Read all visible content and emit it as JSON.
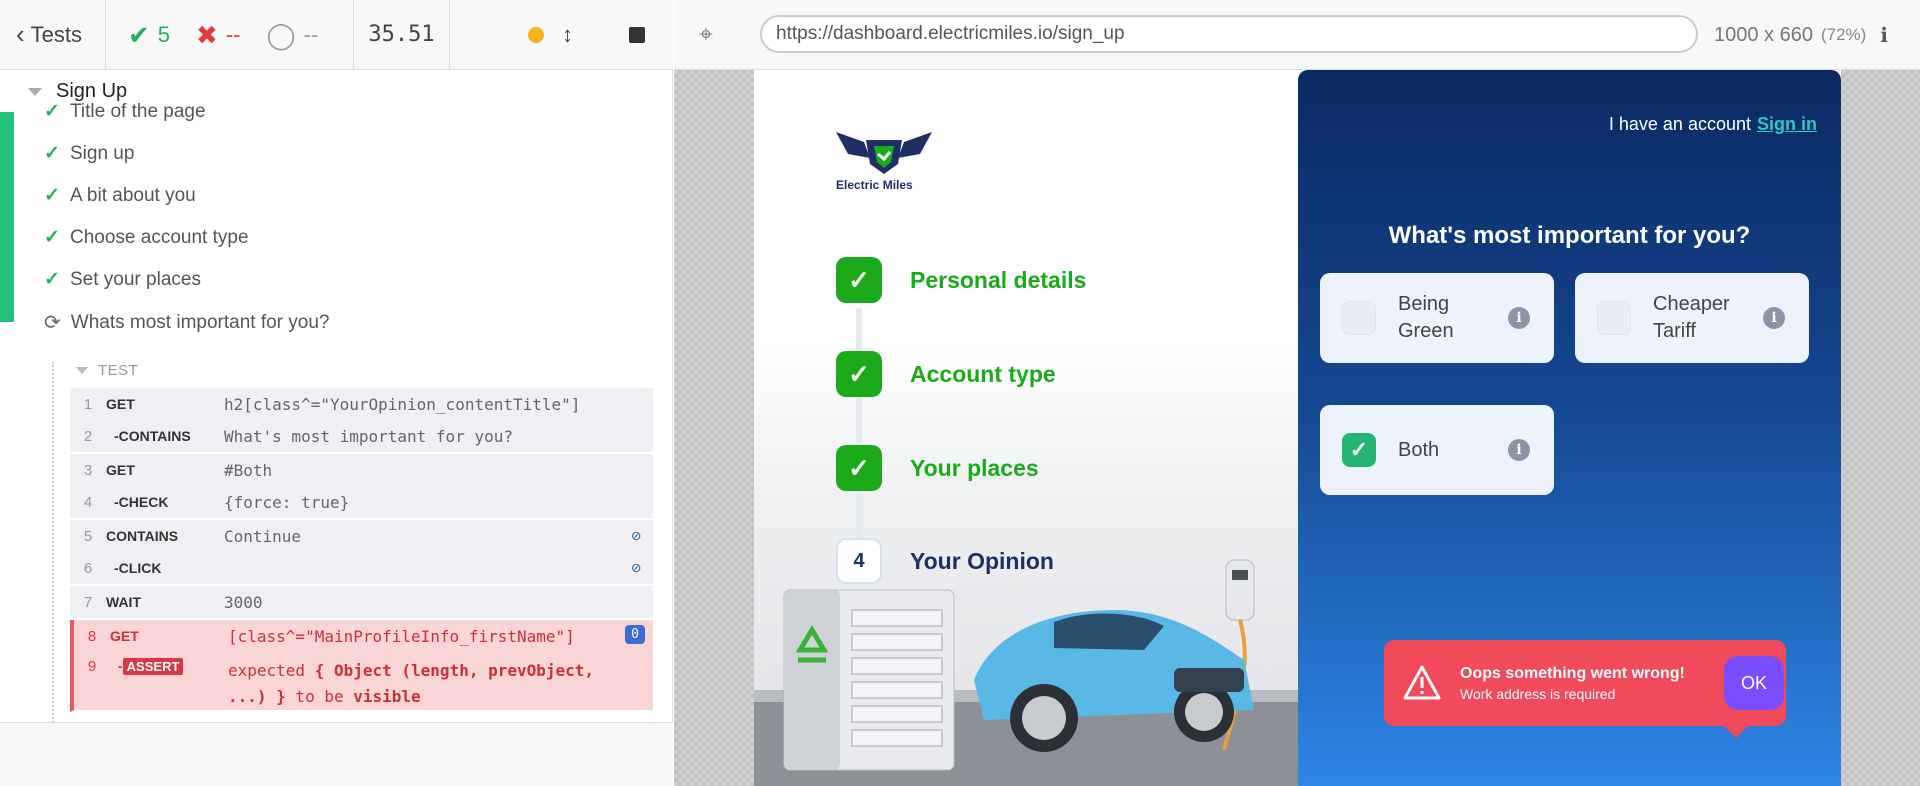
{
  "reporter": {
    "tests_label": "Tests",
    "passed": "5",
    "failed": "--",
    "pending": "--",
    "duration": "35.51",
    "suite_title": "Sign Up",
    "tests": [
      {
        "title": "Title of the page",
        "state": "passed"
      },
      {
        "title": "Sign up",
        "state": "passed"
      },
      {
        "title": "A bit about you",
        "state": "passed"
      },
      {
        "title": "Choose account type",
        "state": "passed"
      },
      {
        "title": "Set your places",
        "state": "passed"
      },
      {
        "title": "Whats most important for you?",
        "state": "running"
      }
    ],
    "test_label": "TEST",
    "commands": [
      {
        "n": "1",
        "name": "GET",
        "msg": "h2[class^=\"YourOpinion_contentTitle\"]"
      },
      {
        "n": "2",
        "name": "-CONTAINS",
        "msg": "What's most important for you?"
      },
      {
        "n": "3",
        "name": "GET",
        "msg": "#Both"
      },
      {
        "n": "4",
        "name": "-CHECK",
        "msg": "{force: true}"
      },
      {
        "n": "5",
        "name": "CONTAINS",
        "msg": "Continue"
      },
      {
        "n": "6",
        "name": "-CLICK",
        "msg": ""
      },
      {
        "n": "7",
        "name": "WAIT",
        "msg": "3000"
      },
      {
        "n": "8",
        "name": "GET",
        "msg": "[class^=\"MainProfileInfo_firstName\"]",
        "badge": "0"
      },
      {
        "n": "9",
        "name_prefix": "-",
        "name": "ASSERT",
        "msg_parts": [
          "expected ",
          "{ Object (length, prevObject, ...) }",
          " to be ",
          "visible"
        ]
      }
    ]
  },
  "aut": {
    "url": "https://dashboard.electricmiles.io/sign_up",
    "viewport": "1000 x 660",
    "scale": "(72%)"
  },
  "app": {
    "logo_text": "Electric Miles",
    "steps": [
      {
        "label": "Personal details",
        "state": "done"
      },
      {
        "label": "Account type",
        "state": "done"
      },
      {
        "label": "Your places",
        "state": "done"
      },
      {
        "label": "Your Opinion",
        "state": "current",
        "number": "4"
      }
    ],
    "have_account": "I have an account",
    "sign_in": "Sign in",
    "question": "What's most important for you?",
    "options": [
      {
        "label": "Being Green",
        "checked": false
      },
      {
        "label": "Cheaper Tariff",
        "checked": false
      },
      {
        "label": "Both",
        "checked": true
      }
    ],
    "toast": {
      "title": "Oops something went wrong!",
      "message": "Work address is required",
      "ok": "OK"
    }
  },
  "colors": {
    "pass": "#22b15c",
    "fail": "#e23a3a",
    "step_done": "#1aaa1a",
    "toast": "#f04a5b",
    "ok_button": "#7a4dff"
  }
}
